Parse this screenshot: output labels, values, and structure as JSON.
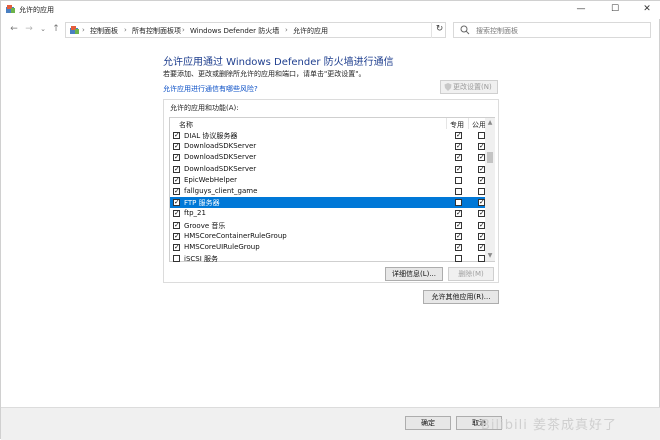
{
  "window": {
    "title": "允许的应用",
    "controls": {
      "minimize": "—",
      "maximize": "☐",
      "close": "✕"
    }
  },
  "nav": {
    "back": "←",
    "forward": "→",
    "recent": "⌄",
    "up": "↑",
    "breadcrumbs": [
      "控制面板",
      "所有控制面板项",
      "Windows Defender 防火墙",
      "允许的应用"
    ],
    "search_placeholder": "搜索控制面板"
  },
  "page": {
    "title": "允许应用通过 Windows Defender 防火墙进行通信",
    "subtitle": "若要添加、更改或删除所允许的应用和端口，请单击\"更改设置\"。",
    "risk_link": "允许应用进行通信有哪些风险?",
    "change_settings": "更改设置(N)"
  },
  "apps_group": {
    "label": "允许的应用和功能(A):",
    "columns": {
      "name": "名称",
      "private": "专用",
      "public": "公用"
    },
    "rows": [
      {
        "name": "DIAL 协议服务器",
        "enabled": true,
        "private": true,
        "public": false
      },
      {
        "name": "DownloadSDKServer",
        "enabled": true,
        "private": true,
        "public": true
      },
      {
        "name": "DownloadSDKServer",
        "enabled": true,
        "private": true,
        "public": true
      },
      {
        "name": "DownloadSDKServer",
        "enabled": true,
        "private": true,
        "public": true
      },
      {
        "name": "EpicWebHelper",
        "enabled": true,
        "private": false,
        "public": true
      },
      {
        "name": "fallguys_client_game",
        "enabled": true,
        "private": false,
        "public": false
      },
      {
        "name": "FTP 服务器",
        "enabled": true,
        "private": false,
        "public": true,
        "selected": true
      },
      {
        "name": "ftp_21",
        "enabled": true,
        "private": true,
        "public": true
      },
      {
        "name": "Groove 音乐",
        "enabled": true,
        "private": true,
        "public": true
      },
      {
        "name": "HMSCoreContainerRuleGroup",
        "enabled": true,
        "private": true,
        "public": true
      },
      {
        "name": "HMSCoreUIRuleGroup",
        "enabled": true,
        "private": true,
        "public": true
      },
      {
        "name": "iSCSI 服务",
        "enabled": false,
        "private": false,
        "public": false
      }
    ],
    "details_button": "详细信息(L)...",
    "remove_button": "删除(M)"
  },
  "allow_other_button": "允许其他应用(R)...",
  "footer": {
    "ok": "确定",
    "cancel": "取消"
  },
  "watermark": "Bilibili 姜茶成真好了"
}
